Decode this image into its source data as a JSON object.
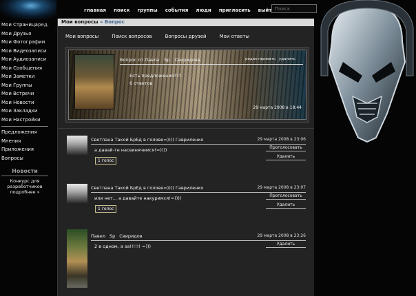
{
  "nav": {
    "items": [
      "главная",
      "поиск",
      "группы",
      "события",
      "люди",
      "пригласить",
      "выйти"
    ],
    "search_placeholder": "Поиск"
  },
  "sidebar": {
    "items": [
      "Мои Страница",
      "Мои Друзья",
      "Мои Фотографии",
      "Мои Видеозаписи",
      "Мои Аудиозаписи",
      "Мои Сообщения",
      "Мои Заметки",
      "Мои Группы",
      "Мои Встречи",
      "Мои Новости",
      "Мои Закладки",
      "Мои Настройки"
    ],
    "edit_label": "ред.",
    "extra": [
      "Предложения",
      "Мнения",
      "Приложения",
      "Вопросы"
    ],
    "news_title": "Новости",
    "news_text": "Конкурс для разработчиков подробнее »"
  },
  "main": {
    "crumb_title": "Мои вопросы",
    "crumb_sub": "Вопрос",
    "tabs": [
      "Мои вопросы",
      "Поиск вопросов",
      "Вопросы друзей",
      "Мои ответы"
    ]
  },
  "question": {
    "author_prefix": "Вопрос от Павла",
    "author_mid": "Sp",
    "author_last": "Свиридова",
    "edit_label": "редактировать",
    "delete_label": "удалить",
    "text": "Есть предложения???",
    "answers_count": "6 ответов",
    "date": "29 марта 2008 в 18:44"
  },
  "answers": [
    {
      "name": "Светлана Такой БрЕд в голове=)))) Гавриленко",
      "date": "29 марта 2008 в 23:06",
      "text": "а давай-те насвинячимся!=))))",
      "vote_label": "Проголосовать",
      "delete_label": "Удалить",
      "badge": "1 голос"
    },
    {
      "name": "Светлана Такой БрЕд в голове=)))) Гавриленко",
      "date": "29 марта 2008 в 23:07",
      "text": "или нет... а давайте накуримся!=))))",
      "vote_label": "Проголосовать",
      "delete_label": "Удалить",
      "badge": "1 голос"
    },
    {
      "name_first": "Павел",
      "name_mid": "Sp",
      "name_last": "Свиридов",
      "date": "29 марта 2008 в 23:26",
      "text": "2 в одном, а за!!!!!! =)))",
      "delete_label": "Удалить"
    }
  ]
}
